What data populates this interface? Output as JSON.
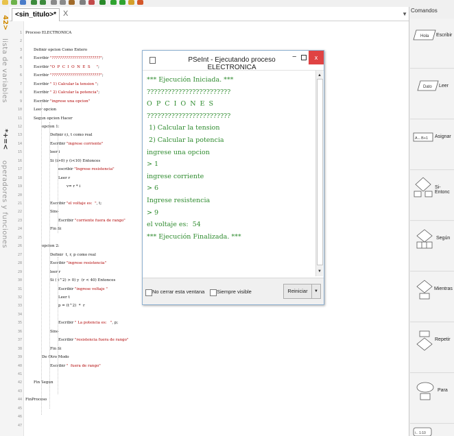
{
  "editor": {
    "tab_title": "<sin_titulo>*",
    "tab_close": "X",
    "line_numbers": [
      "1",
      "2",
      "3",
      "4",
      "5",
      "6",
      "7",
      "8",
      "9",
      "10",
      "11",
      "12",
      "13",
      "14",
      "15",
      "16",
      "17",
      "18",
      "19",
      "20",
      "21",
      "22",
      "23",
      "24",
      "25",
      "26",
      "27",
      "28",
      "29",
      "30",
      "31",
      "32",
      "33",
      "34",
      "35",
      "36",
      "37",
      "38",
      "39",
      "40",
      "41",
      "42",
      "43",
      "44",
      "45",
      "46",
      "47"
    ],
    "lines": [
      "Proceso ELECTRONICA",
      "",
      "Definir opcion Como Entero",
      "Escribir \"????????????????????????\";",
      "Escribir \"O  P  C  I  O  N  E  S     \";",
      "Escribir \"????????????????????????\";",
      "Escribir \" 1) Calcular la tension \";",
      "Escribir \" 2) Calcular la potencia\";",
      "Escribir \"ingrese una opcion\"",
      "Leer opcion",
      "Segun opcion Hacer",
      "opcion 1:",
      "Definir r,i, t como real",
      "Escribir \"ingrese corriente\"",
      "leer i",
      "Si (i>0) y (i<10) Entonces",
      "escribir \"Ingrese resistencia\"",
      "Leer r",
      "v= r * i",
      "",
      "Escribir \"el voltaje es:  \", t;",
      "Sino",
      "Escribir \"corriente fuera de rango\"",
      "Fin Si",
      "",
      "opcion 2:",
      "Definir  t, r, p como real",
      "Escribir \"ingrese resistencia\"",
      "leer r",
      "Si ( t^2) > 0) y  (r < 40) Entonces",
      "Escribir \"ingrese voltaje \"",
      "Leer t",
      "p = (t^2)  *  r",
      "",
      "Escribir \" La potencia es:   \", p;",
      "Sino",
      "Escribir \"resistencia fuera de rango\"",
      "Fin Si",
      "De Otro Modo",
      "Escribir \"  fuera de rango\"",
      "",
      "Fin Segun",
      "",
      "FinProceso",
      "",
      "",
      ""
    ]
  },
  "left_strip": {
    "symbols": "42>",
    "label_vars": "lista de variables",
    "operators": "*+=<",
    "label_ops": "operadores y funciones"
  },
  "right_panel": {
    "title": "Comandos",
    "commands": [
      {
        "label": "Escribir",
        "shape_text": "Hola"
      },
      {
        "label": "Leer",
        "shape_text": "Dato"
      },
      {
        "label": "Asignar",
        "shape_text": "A←B+1"
      },
      {
        "label": "Si-Entonc",
        "shape_text": ""
      },
      {
        "label": "Según",
        "shape_text": ""
      },
      {
        "label": "Mientras",
        "shape_text": ""
      },
      {
        "label": "Repetir",
        "shape_text": ""
      },
      {
        "label": "Para",
        "shape_text": ""
      },
      {
        "label": "",
        "shape_text": "i←1:10"
      }
    ]
  },
  "dialog": {
    "title": "PSeInt - Ejecutando proceso ELECTRONICA",
    "minimize": "−",
    "close": "x",
    "console_lines": [
      "*** Ejecución Iniciada. ***",
      "????????????????????????",
      "O  P  C  I  O  N  E  S",
      "????????????????????????",
      " 1) Calcular la tension",
      " 2) Calcular la potencia",
      "ingrese una opcion",
      "> 1",
      "ingrese corriente",
      "> 6",
      "Ingrese resistencia",
      "> 9",
      "el voltaje es:  54",
      "*** Ejecución Finalizada. ***"
    ],
    "no_cerrar": "No cerrar esta ventana",
    "siempre_visible": "Siempre visible",
    "reiniciar": "Reiniciar"
  },
  "colors": {
    "console_green": "#2e8b2e",
    "close_red": "#e04343",
    "string_red": "#b00000"
  }
}
